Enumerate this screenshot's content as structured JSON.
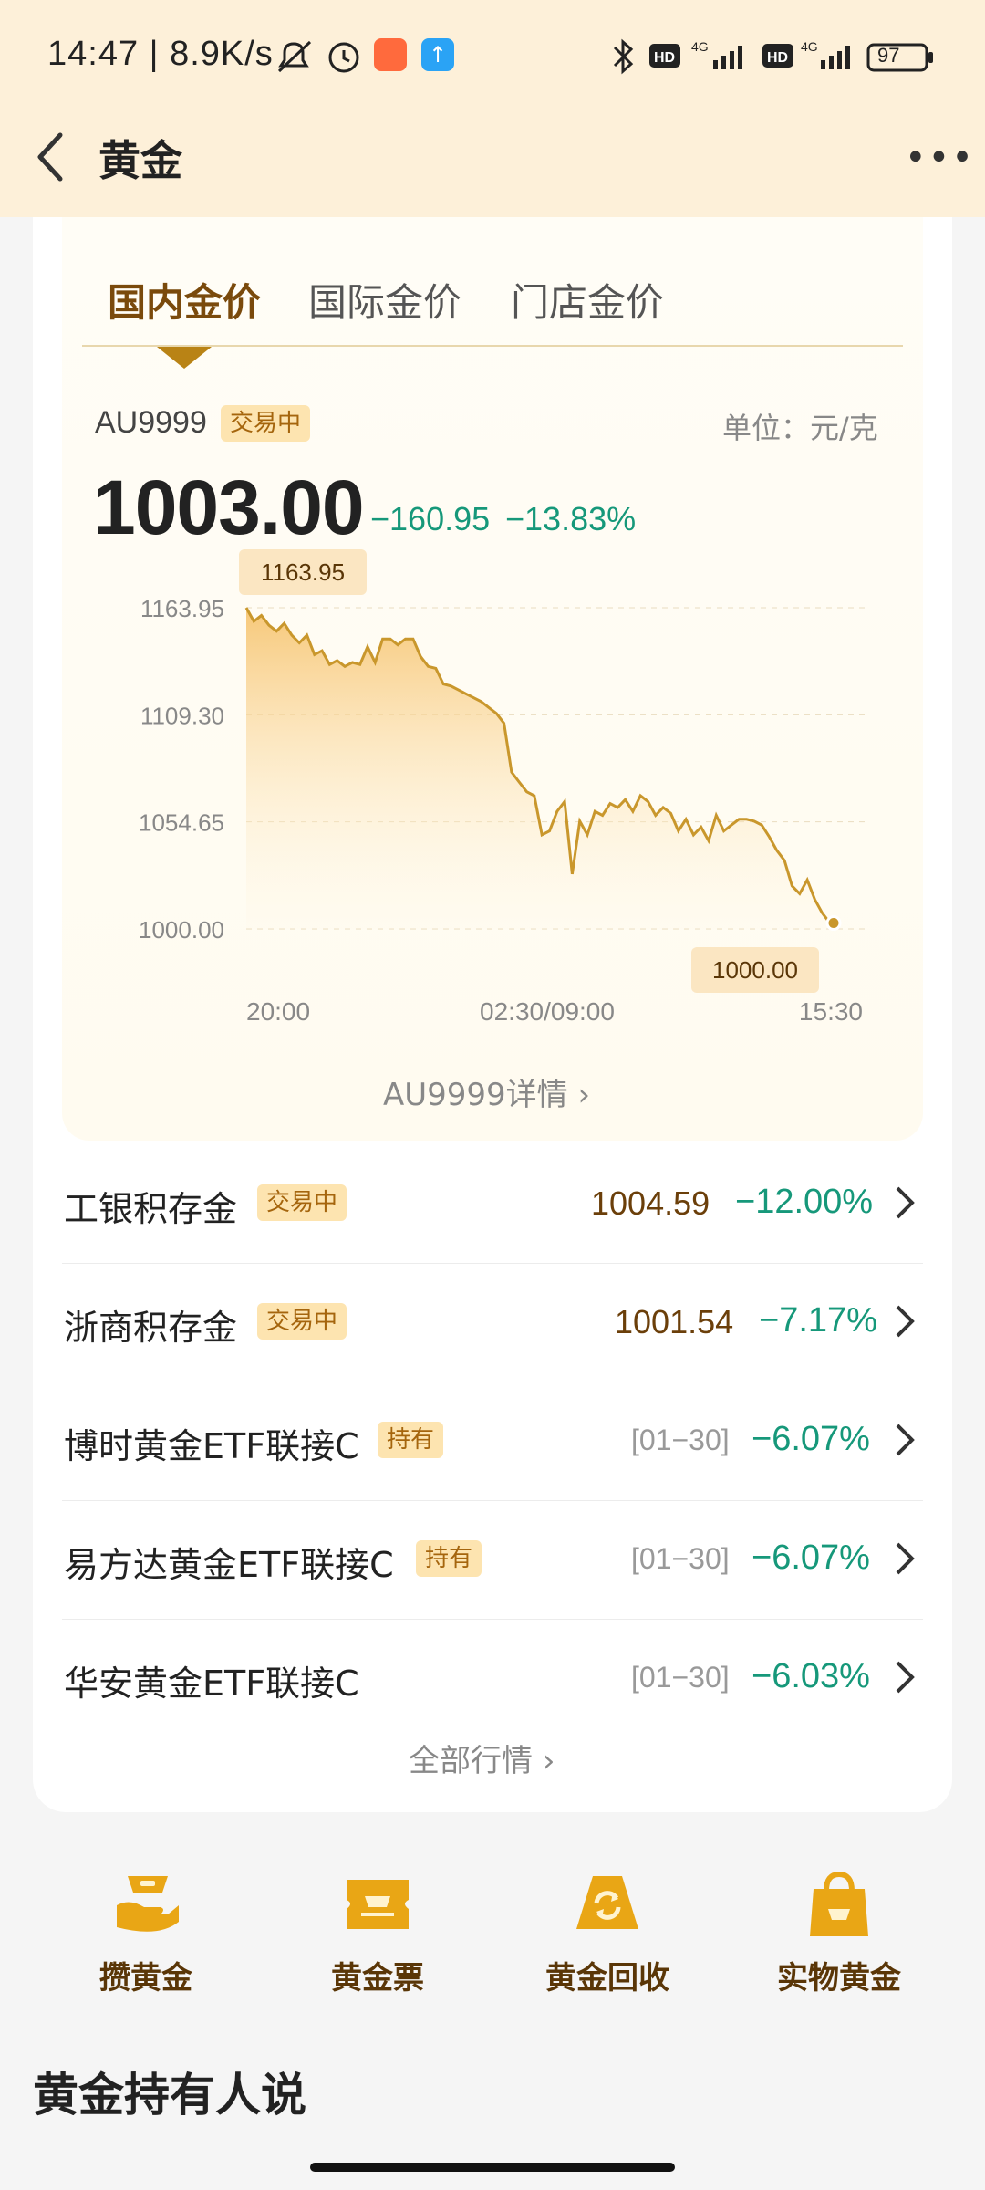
{
  "status": {
    "time_speed": "14:47 | 8.9K/s",
    "battery": "97"
  },
  "header": {
    "title": "黄金"
  },
  "tabs": [
    {
      "label": "国内金价"
    },
    {
      "label": "国际金价"
    },
    {
      "label": "门店金价"
    }
  ],
  "quote": {
    "code": "AU9999",
    "status": "交易中",
    "unit": "单位：元/克",
    "price": "1003.00",
    "change": "−160.95",
    "change_pct": "−13.83%"
  },
  "chart_data": {
    "type": "area",
    "ylim": [
      1000.0,
      1163.95
    ],
    "y_ticks": [
      "1163.95",
      "1109.30",
      "1054.65",
      "1000.00"
    ],
    "x_ticks": [
      "20:00",
      "02:30/09:00",
      "15:30"
    ],
    "max_label": "1163.95",
    "min_label": "1000.00",
    "values": [
      1163.95,
      1157,
      1160,
      1155,
      1152,
      1156,
      1150,
      1146,
      1150,
      1140,
      1142,
      1135,
      1137,
      1134,
      1136,
      1135,
      1144,
      1136,
      1148,
      1148,
      1145,
      1148,
      1148,
      1139,
      1134,
      1133,
      1125,
      1124,
      1122,
      1120,
      1118,
      1116,
      1113,
      1110,
      1105,
      1080,
      1075,
      1070,
      1068,
      1048,
      1050,
      1060,
      1065,
      1028,
      1055,
      1048,
      1060,
      1058,
      1064,
      1062,
      1066,
      1060,
      1068,
      1065,
      1058,
      1062,
      1059,
      1050,
      1056,
      1048,
      1052,
      1045,
      1058,
      1050,
      1053,
      1056,
      1056,
      1055,
      1053,
      1047,
      1040,
      1035,
      1022,
      1018,
      1025,
      1015,
      1008,
      1003
    ]
  },
  "detail_link": "AU9999详情",
  "list": [
    {
      "name": "工银积存金",
      "tag": "交易中",
      "value": "1004.59",
      "pct": "−12.00%"
    },
    {
      "name": "浙商积存金",
      "tag": "交易中",
      "value": "1001.54",
      "pct": "−7.17%"
    },
    {
      "name": "博时黄金ETF联接C",
      "tag": "持有",
      "date": "[01−30]",
      "pct": "−6.07%"
    },
    {
      "name": "易方达黄金ETF联接C",
      "tag": "持有",
      "date": "[01−30]",
      "pct": "−6.07%"
    },
    {
      "name": "华安黄金ETF联接C",
      "date": "[01−30]",
      "pct": "−6.03%"
    }
  ],
  "all_market": "全部行情",
  "shortcuts": [
    {
      "label": "攒黄金",
      "icon": "gold-bar-hand-icon"
    },
    {
      "label": "黄金票",
      "icon": "gold-ticket-icon"
    },
    {
      "label": "黄金回收",
      "icon": "gold-recycle-icon"
    },
    {
      "label": "实物黄金",
      "icon": "shopping-bag-icon"
    }
  ],
  "section_title": "黄金持有人说",
  "colors": {
    "gold": "#e9a615",
    "green": "#16987a",
    "brown": "#6b3f0a",
    "header_bg": "#fdf0d9"
  }
}
